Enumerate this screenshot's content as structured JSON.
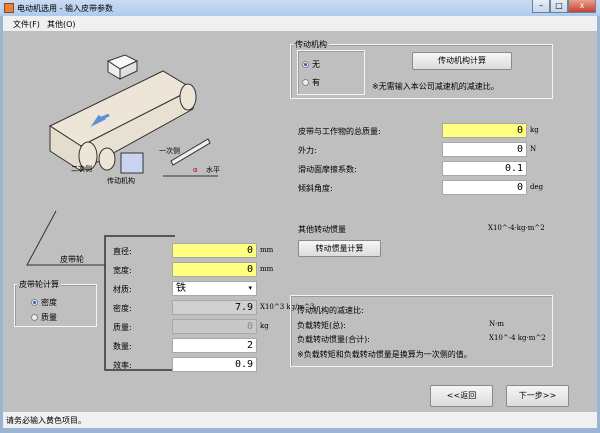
{
  "window": {
    "title": "电动机选用 - 输入皮带参数",
    "minimize": "–",
    "maximize": "□",
    "close": "x"
  },
  "menu": {
    "items": [
      "文件(F)",
      "其他(O)"
    ]
  },
  "illustration": {
    "primary_side": "一次侧",
    "secondary_side": "二次侧",
    "mechanism": "传动机构",
    "horizontal": "水平",
    "angle": "α"
  },
  "transmission": {
    "group_label": "传动机构",
    "options": [
      "无",
      "有"
    ],
    "selected": 0,
    "calc_button": "传动机构计算",
    "note": "※无需输入本公司减速机的减速比。"
  },
  "params": [
    {
      "label": "皮带与工作物的总质量:",
      "value": "0",
      "unit": "kg",
      "required": true
    },
    {
      "label": "外力:",
      "value": "0",
      "unit": "N",
      "required": false
    },
    {
      "label": "滑动面摩擦系数:",
      "value": "0.1",
      "unit": "",
      "required": false
    },
    {
      "label": "倾斜角度:",
      "value": "0",
      "unit": "deg",
      "required": false
    }
  ],
  "inertia": {
    "label": "其他转动惯量",
    "unit": "X10^-4·kg·m^2",
    "button": "转动惯量计算"
  },
  "results": {
    "ratio_label": "传动机构的减速比:",
    "torque_label": "负载转矩(总):",
    "torque_unit": "N·m",
    "inertia_label": "负载转动惯量(合计):",
    "inertia_unit": "X10^-4 kg·m^2",
    "note": "※负载转矩和负载转动惯量是换算为一次侧的值。"
  },
  "pulley": {
    "label": "皮带轮",
    "calc_group": "皮带轮计算",
    "calc_options": [
      "密度",
      "质量"
    ],
    "calc_selected": 0,
    "fields": [
      {
        "label": "直径:",
        "value": "0",
        "unit": "mm"
      },
      {
        "label": "宽度:",
        "value": "0",
        "unit": "mm"
      },
      {
        "label": "材质:",
        "value": "铁",
        "unit": ""
      },
      {
        "label": "密度:",
        "value": "7.9",
        "unit": "X10^3 kg/m^3"
      },
      {
        "label": "质量:",
        "value": "0",
        "unit": "kg"
      },
      {
        "label": "数量:",
        "value": "2",
        "unit": ""
      },
      {
        "label": "效率:",
        "value": "0.9",
        "unit": ""
      }
    ]
  },
  "nav": {
    "back": "<<返回",
    "next": "下一步>>"
  },
  "status": "请务必输入黄色项目。"
}
